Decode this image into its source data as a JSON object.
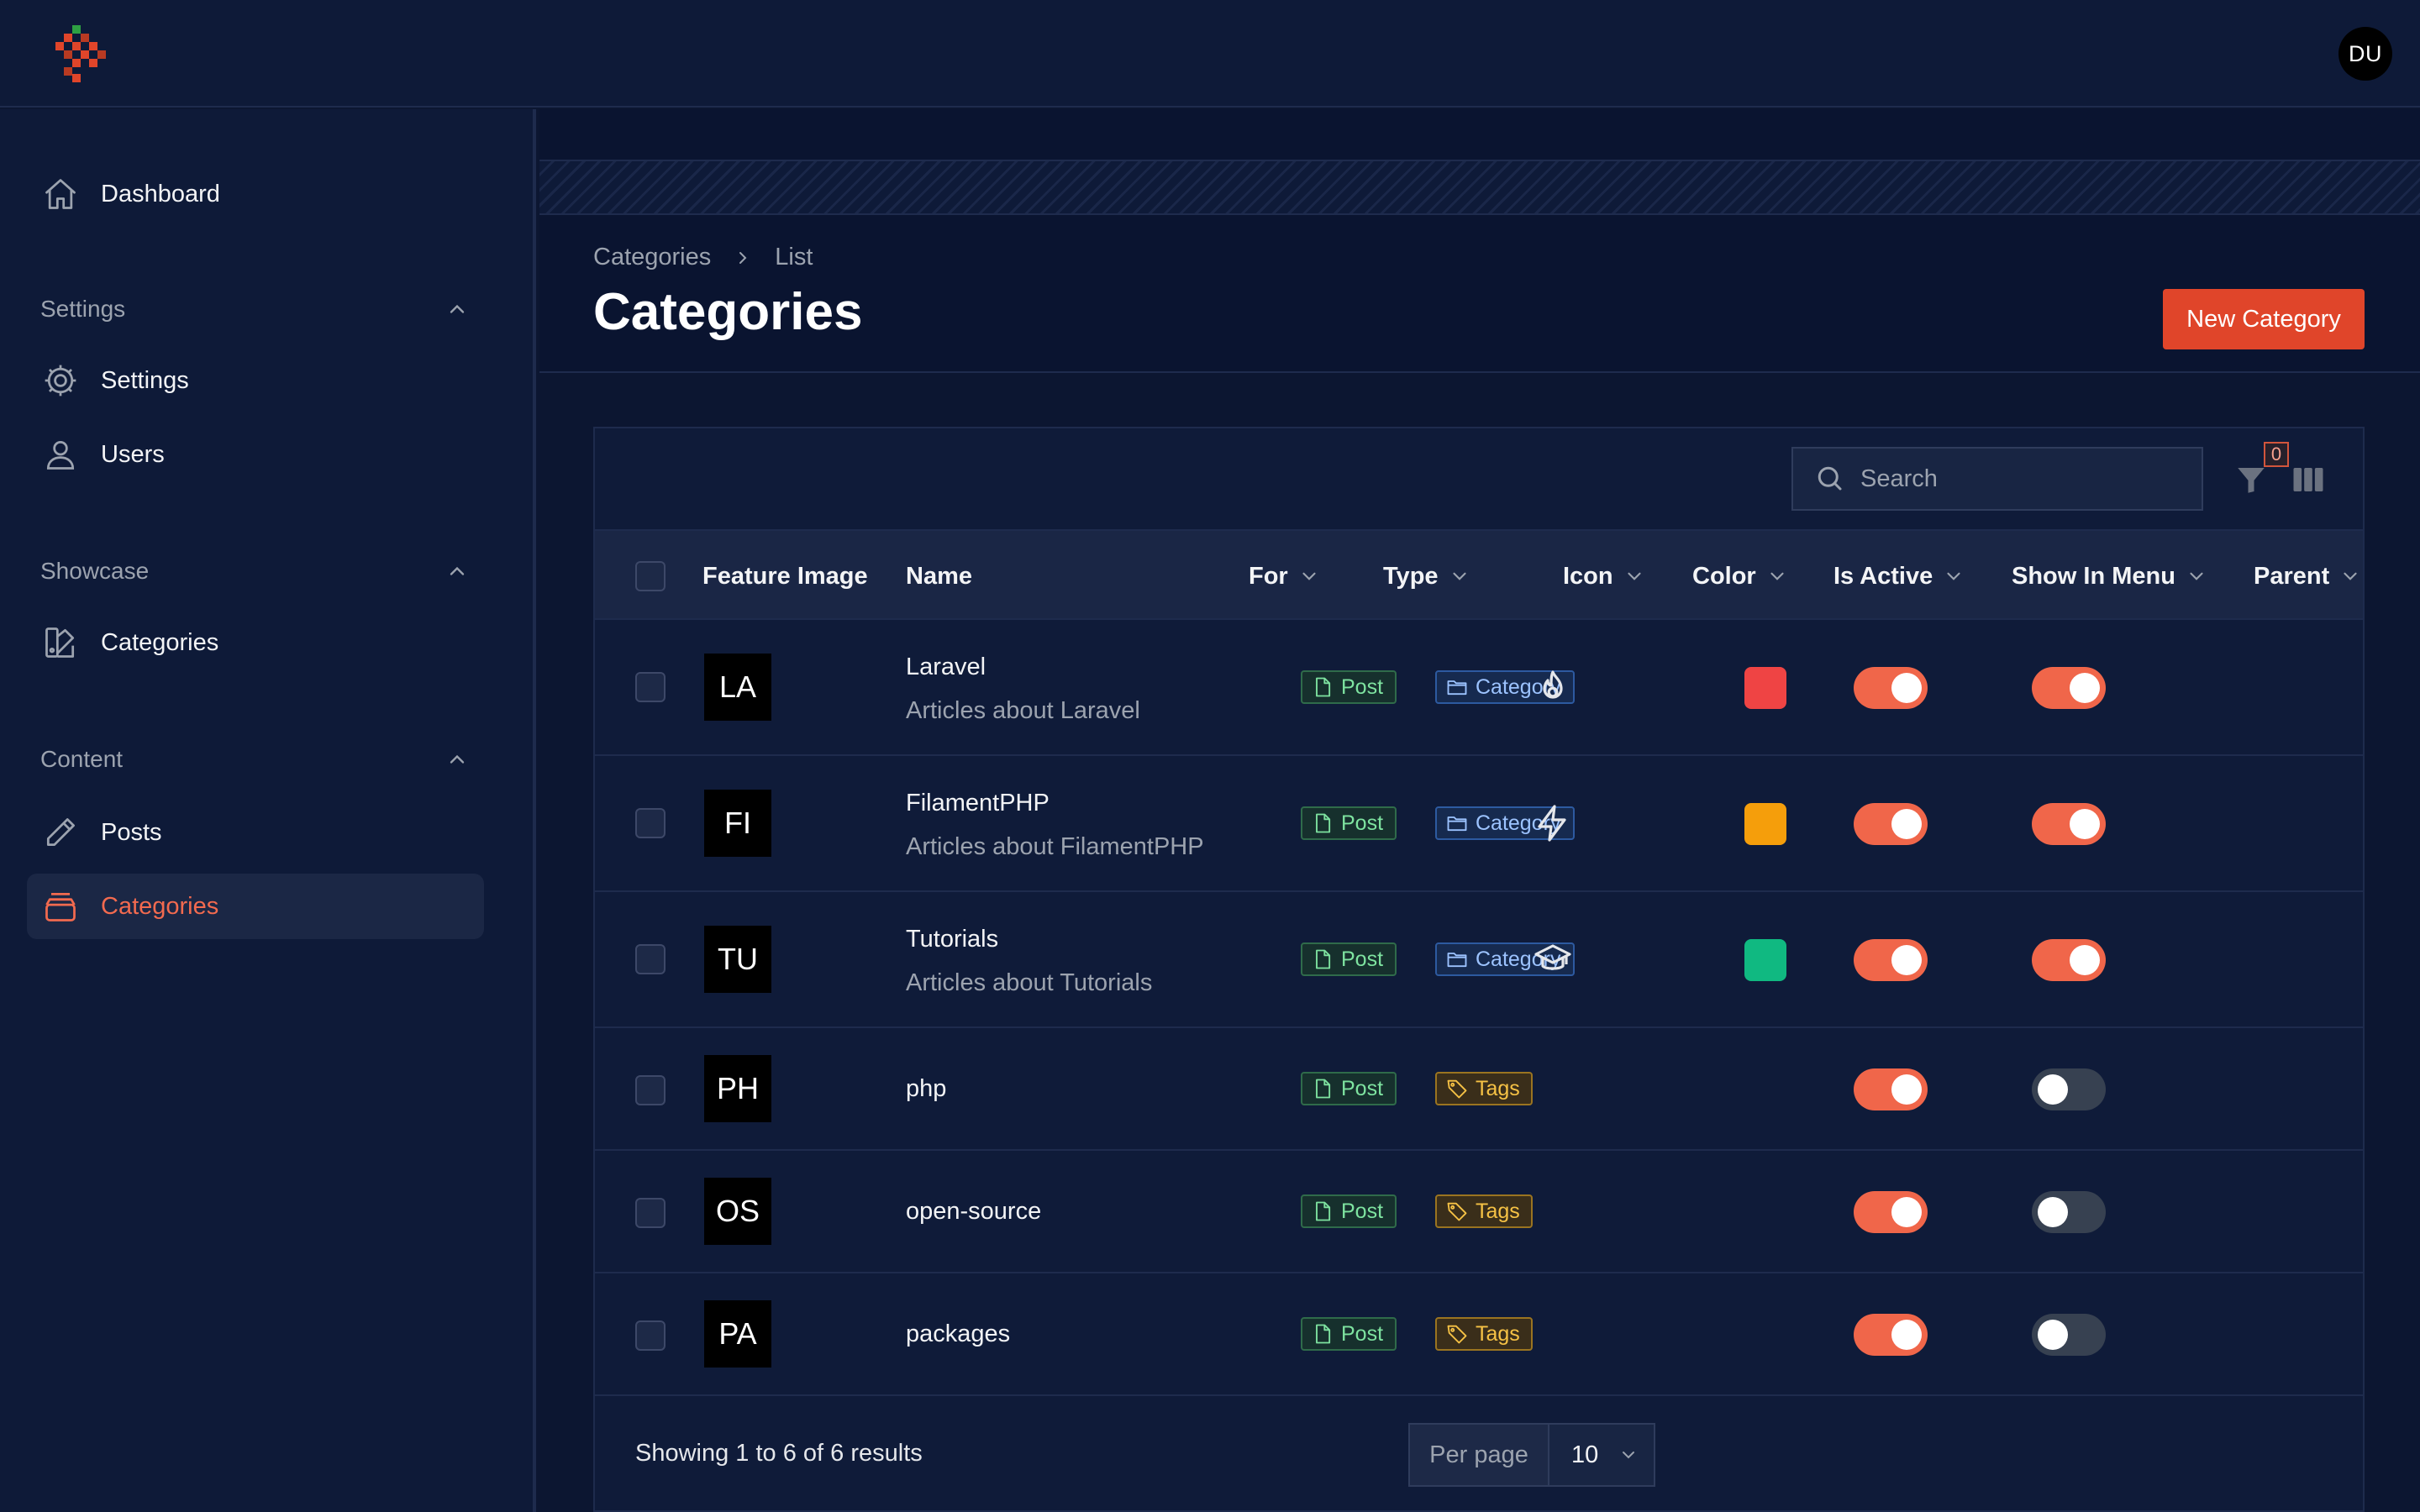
{
  "header": {
    "avatar_initials": "DU"
  },
  "sidebar": {
    "dashboard_label": "Dashboard",
    "groups": [
      {
        "label": "Settings",
        "items": [
          {
            "label": "Settings",
            "icon": "cog-icon"
          },
          {
            "label": "Users",
            "icon": "user-icon"
          }
        ]
      },
      {
        "label": "Showcase",
        "items": [
          {
            "label": "Categories",
            "icon": "swatch-icon"
          }
        ]
      },
      {
        "label": "Content",
        "items": [
          {
            "label": "Posts",
            "icon": "pencil-icon"
          },
          {
            "label": "Categories",
            "icon": "archive-box-icon",
            "active": true
          }
        ]
      }
    ]
  },
  "page": {
    "breadcrumb": [
      "Categories",
      "List"
    ],
    "title": "Categories",
    "new_button": "New Category"
  },
  "toolbar": {
    "search_placeholder": "Search",
    "filter_count": "0"
  },
  "table": {
    "columns": [
      "Feature Image",
      "Name",
      "For",
      "Type",
      "Icon",
      "Color",
      "Is Active",
      "Show In Menu",
      "Parent"
    ],
    "rows": [
      {
        "initials": "LA",
        "name": "Laravel",
        "description": "Articles about Laravel",
        "for": "Post",
        "type": "Category",
        "icon": "fire-icon",
        "color": "#ef4444",
        "is_active": true,
        "show_in_menu": true
      },
      {
        "initials": "FI",
        "name": "FilamentPHP",
        "description": "Articles about FilamentPHP",
        "for": "Post",
        "type": "Category",
        "icon": "bolt-icon",
        "color": "#f59e0b",
        "is_active": true,
        "show_in_menu": true
      },
      {
        "initials": "TU",
        "name": "Tutorials",
        "description": "Articles about Tutorials",
        "for": "Post",
        "type": "Category",
        "icon": "academic-cap-icon",
        "color": "#10b981",
        "is_active": true,
        "show_in_menu": true
      },
      {
        "initials": "PH",
        "name": "php",
        "description": "",
        "for": "Post",
        "type": "Tags",
        "icon": "",
        "color": "",
        "is_active": true,
        "show_in_menu": false
      },
      {
        "initials": "OS",
        "name": "open-source",
        "description": "",
        "for": "Post",
        "type": "Tags",
        "icon": "",
        "color": "",
        "is_active": true,
        "show_in_menu": false
      },
      {
        "initials": "PA",
        "name": "packages",
        "description": "",
        "for": "Post",
        "type": "Tags",
        "icon": "",
        "color": "",
        "is_active": true,
        "show_in_menu": false
      }
    ]
  },
  "footer": {
    "results": "Showing 1 to 6 of 6 results",
    "per_page_label": "Per page",
    "per_page_value": "10"
  },
  "colors": {
    "accent": "#e0452a",
    "active_text": "#f26a4f",
    "toggle_on": "#f0664a"
  }
}
